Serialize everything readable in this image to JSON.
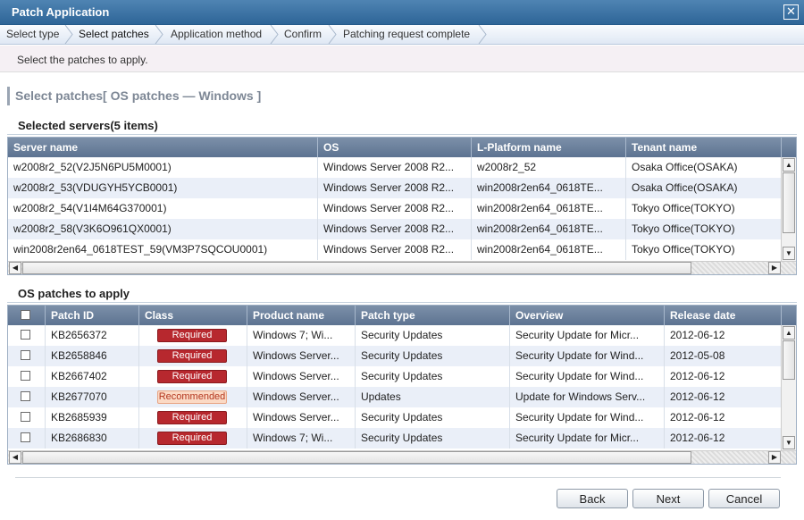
{
  "window": {
    "title": "Patch Application"
  },
  "steps": [
    "Select type",
    "Select patches",
    "Application method",
    "Confirm",
    "Patching request complete"
  ],
  "active_step": 1,
  "instruction": "Select the patches to apply.",
  "section_title": "Select patches[ OS patches ― Windows ]",
  "servers": {
    "title": "Selected servers(5 items)",
    "columns": [
      "Server name",
      "OS",
      "L-Platform name",
      "Tenant name"
    ],
    "rows": [
      [
        "w2008r2_52(V2J5N6PU5M0001)",
        "Windows Server 2008 R2...",
        "w2008r2_52",
        "Osaka Office(OSAKA)"
      ],
      [
        "w2008r2_53(VDUGYH5YCB0001)",
        "Windows Server 2008 R2...",
        "win2008r2en64_0618TE...",
        "Osaka Office(OSAKA)"
      ],
      [
        "w2008r2_54(V1I4M64G370001)",
        "Windows Server 2008 R2...",
        "win2008r2en64_0618TE...",
        "Tokyo Office(TOKYO)"
      ],
      [
        "w2008r2_58(V3K6O961QX0001)",
        "Windows Server 2008 R2...",
        "win2008r2en64_0618TE...",
        "Tokyo Office(TOKYO)"
      ],
      [
        "win2008r2en64_0618TEST_59(VM3P7SQCOU0001)",
        "Windows Server 2008 R2...",
        "win2008r2en64_0618TE...",
        "Tokyo Office(TOKYO)"
      ]
    ]
  },
  "patches": {
    "title": "OS patches to apply",
    "columns": [
      "Patch ID",
      "Class",
      "Product name",
      "Patch type",
      "Overview",
      "Release date"
    ],
    "rows": [
      {
        "id": "KB2656372",
        "class": "Required",
        "product": "Windows 7; Wi...",
        "type": "Security Updates",
        "overview": "Security Update for Micr...",
        "date": "2012-06-12"
      },
      {
        "id": "KB2658846",
        "class": "Required",
        "product": "Windows Server...",
        "type": "Security Updates",
        "overview": "Security Update for Wind...",
        "date": "2012-05-08"
      },
      {
        "id": "KB2667402",
        "class": "Required",
        "product": "Windows Server...",
        "type": "Security Updates",
        "overview": "Security Update for Wind...",
        "date": "2012-06-12"
      },
      {
        "id": "KB2677070",
        "class": "Recommended",
        "product": "Windows Server...",
        "type": "Updates",
        "overview": "Update for Windows Serv...",
        "date": "2012-06-12"
      },
      {
        "id": "KB2685939",
        "class": "Required",
        "product": "Windows Server...",
        "type": "Security Updates",
        "overview": "Security Update for Wind...",
        "date": "2012-06-12"
      },
      {
        "id": "KB2686830",
        "class": "Required",
        "product": "Windows 7; Wi...",
        "type": "Security Updates",
        "overview": "Security Update for Micr...",
        "date": "2012-06-12"
      }
    ]
  },
  "buttons": {
    "back": "Back",
    "next": "Next",
    "cancel": "Cancel"
  },
  "icons": {
    "close": "close-icon",
    "check": "checkbox-icon"
  },
  "colors": {
    "titlebar": "#2e6597",
    "header": "#5d7391",
    "required": "#b7282e",
    "recommended": "#fbd9c4",
    "row_alt": "#eaeff8"
  }
}
